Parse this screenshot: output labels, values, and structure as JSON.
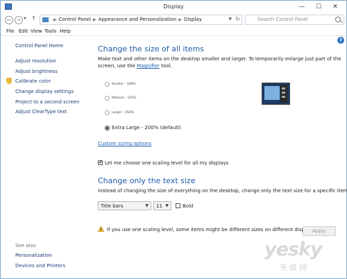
{
  "window": {
    "title": "Display",
    "controls": {
      "minimize": "—",
      "maximize": "☐",
      "close": "✕"
    }
  },
  "address": {
    "crumbs": [
      "Control Panel",
      "Appearance and Personalization",
      "Display"
    ],
    "search_placeholder": "Search Control Panel"
  },
  "menu": [
    "File",
    "Edit",
    "View",
    "Tools",
    "Help"
  ],
  "sidebar": {
    "home": "Control Panel Home",
    "links": [
      "Adjust resolution",
      "Adjust brightness",
      "Calibrate color",
      "Change display settings",
      "Project to a second screen",
      "Adjust ClearType text"
    ],
    "see_also_label": "See also",
    "see_also": [
      "Personalization",
      "Devices and Printers"
    ]
  },
  "main": {
    "heading": "Change the size of all items",
    "desc_line1": "Make text and other items on the desktop smaller and larger. To temporarily enlarge just part of the",
    "desc_line2_prefix": "screen, use the ",
    "desc_link": "Magnifier",
    "desc_line2_suffix": " tool.",
    "options": [
      {
        "label": "Smaller - 100%",
        "selected": false
      },
      {
        "label": "Medium - 125%",
        "selected": false
      },
      {
        "label": "Larger - 150%",
        "selected": false
      },
      {
        "label": "Extra Large - 200% (default)",
        "selected": true
      }
    ],
    "custom_link": "Custom sizing options",
    "scaling_checkbox": {
      "label": "Let me choose one scaling level for all my displays",
      "checked": true
    },
    "text_heading": "Change only the text size",
    "text_desc": "Instead of changing the size of everything on the desktop, change only the text size for a specific item.",
    "item_select": "Title bars",
    "size_select": "11",
    "bold_label": "Bold",
    "bold_checked": false,
    "warning": "If you use one scaling level, some items might be different sizes on different displays.",
    "apply": "Apply"
  },
  "watermark": {
    "text": "yesky",
    "sub": "天极网"
  }
}
